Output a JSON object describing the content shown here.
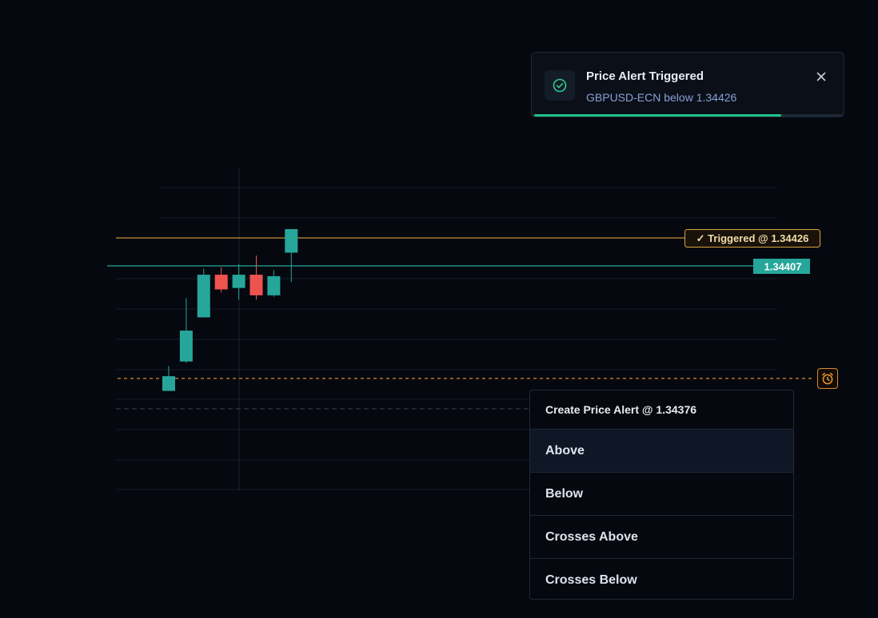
{
  "notification": {
    "title": "Price Alert Triggered",
    "message": "GBPUSD-ECN below 1.34426",
    "progress": 0.8,
    "icon": "check-circle-icon",
    "close_icon": "close-icon"
  },
  "chart": {
    "triggered_label": "✓ Triggered @ 1.34426",
    "current_price_label": "1.34407",
    "colors": {
      "up": "#26a69a",
      "down": "#ef5350",
      "triggered": "#d9a441",
      "alert_line": "#d98c2c",
      "grid": "#161d2a"
    }
  },
  "chart_data": {
    "type": "candlestick",
    "candles": [
      {
        "open": 1.34322,
        "high": 1.34339,
        "low": 1.34322,
        "close": 1.34332
      },
      {
        "open": 1.34342,
        "high": 1.34385,
        "low": 1.34341,
        "close": 1.34363
      },
      {
        "open": 1.34372,
        "high": 1.34405,
        "low": 1.34372,
        "close": 1.34401
      },
      {
        "open": 1.34401,
        "high": 1.34406,
        "low": 1.34389,
        "close": 1.34391
      },
      {
        "open": 1.34392,
        "high": 1.34408,
        "low": 1.34384,
        "close": 1.34401
      },
      {
        "open": 1.34401,
        "high": 1.34414,
        "low": 1.34384,
        "close": 1.34387
      },
      {
        "open": 1.34387,
        "high": 1.34404,
        "low": 1.34386,
        "close": 1.344
      },
      {
        "open": 1.34416,
        "high": 1.34432,
        "low": 1.34396,
        "close": 1.34432
      }
    ],
    "triggered_price": 1.34426,
    "current_price": 1.34407,
    "alert_price": 1.34376
  },
  "alert_button": {
    "icon": "alarm-clock-icon"
  },
  "menu": {
    "title": "Create Price Alert @ 1.34376",
    "items": [
      {
        "label": "Above"
      },
      {
        "label": "Below"
      },
      {
        "label": "Crosses Above"
      },
      {
        "label": "Crosses Below"
      }
    ]
  }
}
